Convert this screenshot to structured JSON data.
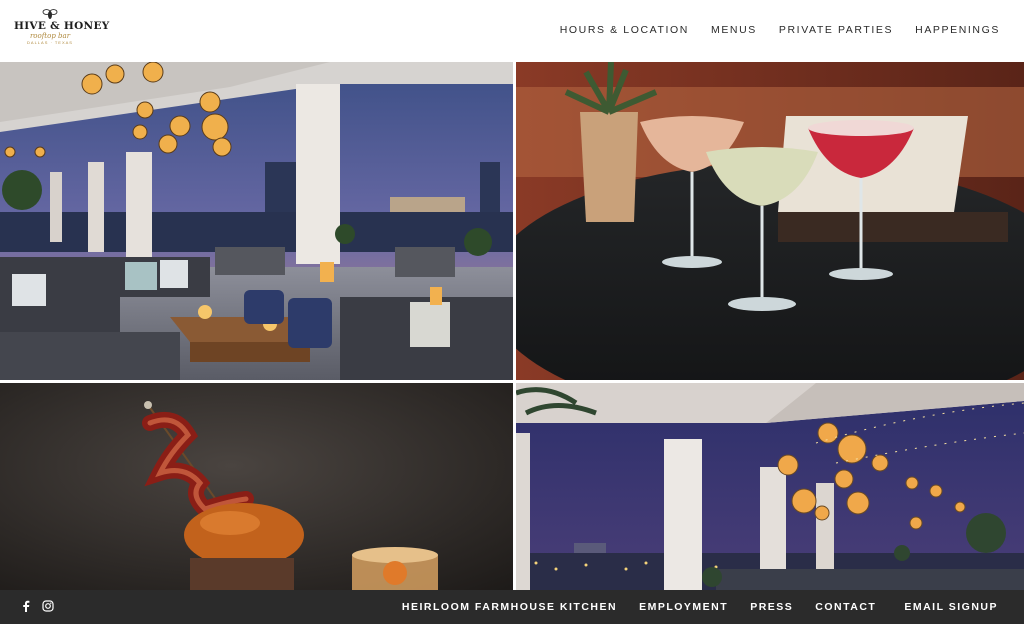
{
  "header": {
    "logo_main": "HIVE & HONEY",
    "logo_sub": "rooftop bar",
    "logo_tag": "DALLAS · TEXAS",
    "nav": [
      "HOURS & LOCATION",
      "MENUS",
      "PRIVATE PARTIES",
      "HAPPENINGS"
    ]
  },
  "gallery": {
    "photos": [
      "rooftop-lounge-dusk",
      "three-cocktails-on-table",
      "bacon-burger-and-old-fashioned",
      "rooftop-terrace-night"
    ]
  },
  "footer": {
    "social_icons": [
      "facebook-icon",
      "instagram-icon"
    ],
    "links": [
      "HEIRLOOM FARMHOUSE KITCHEN",
      "EMPLOYMENT",
      "PRESS",
      "CONTACT"
    ],
    "signup": "EMAIL SIGNUP"
  },
  "colors": {
    "footer_bg": "#2b2b2b",
    "accent_gold": "#b08a3e",
    "nav_text": "#2a2a2a"
  }
}
